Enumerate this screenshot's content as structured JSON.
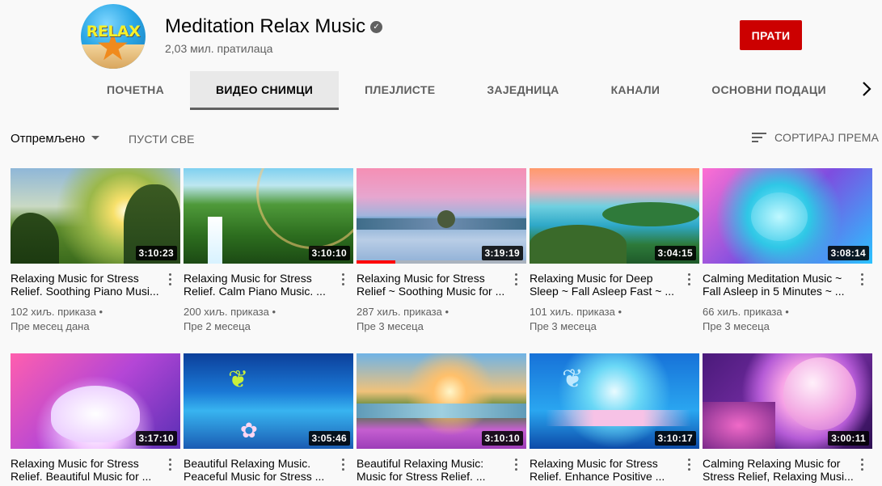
{
  "channel": {
    "avatar_text": "RELAX",
    "name": "Meditation Relax Music",
    "subscribers": "2,03 мил. пратилаца",
    "subscribe_label": "ПРАТИ"
  },
  "tabs": [
    {
      "label": "ПОЧЕТНА"
    },
    {
      "label": "ВИДЕО СНИМЦИ"
    },
    {
      "label": "ПЛЕЈЛИСТЕ"
    },
    {
      "label": "ЗАЈЕДНИЦА"
    },
    {
      "label": "КАНАЛИ"
    },
    {
      "label": "ОСНОВНИ ПОДАЦИ"
    }
  ],
  "toolbar": {
    "filter_label": "Отпремљено",
    "play_all_label": "ПУСТИ СВЕ",
    "sort_label": "СОРТИРАЈ ПРЕМА"
  },
  "videos": [
    {
      "title": "Relaxing Music for Stress Relief. Soothing Piano Musi...",
      "duration": "3:10:23",
      "views": "102 хиљ. приказа •",
      "date": "Пре месец дана"
    },
    {
      "title": "Relaxing Music for Stress Relief. Calm Piano Music. ...",
      "duration": "3:10:10",
      "views": "200 хиљ. приказа •",
      "date": "Пре 2 месеца"
    },
    {
      "title": "Relaxing Music for Stress Relief ~ Soothing Music for ...",
      "duration": "3:19:19",
      "views": "287 хиљ. приказа •",
      "date": "Пре 3 месеца",
      "watched_fraction": 0.23
    },
    {
      "title": "Relaxing Music for Deep Sleep ~ Fall Asleep Fast ~ ...",
      "duration": "3:04:15",
      "views": "101 хиљ. приказа •",
      "date": "Пре 3 месеца"
    },
    {
      "title": "Calming Meditation Music ~ Fall Asleep in 5 Minutes ~ ...",
      "duration": "3:08:14",
      "views": "66 хиљ. приказа •",
      "date": "Пре 3 месеца"
    },
    {
      "title": "Relaxing Music for Stress Relief. Beautiful Music for ...",
      "duration": "3:17:10"
    },
    {
      "title": "Beautiful Relaxing Music. Peaceful Music for Stress ...",
      "duration": "3:05:46"
    },
    {
      "title": "Beautiful Relaxing Music: Music for Stress Relief. ...",
      "duration": "3:10:10"
    },
    {
      "title": "Relaxing Music for Stress Relief. Enhance Positive ...",
      "duration": "3:10:17"
    },
    {
      "title": "Calming Relaxing Music for Stress Relief, Relaxing Musi...",
      "duration": "3:00:11"
    }
  ]
}
